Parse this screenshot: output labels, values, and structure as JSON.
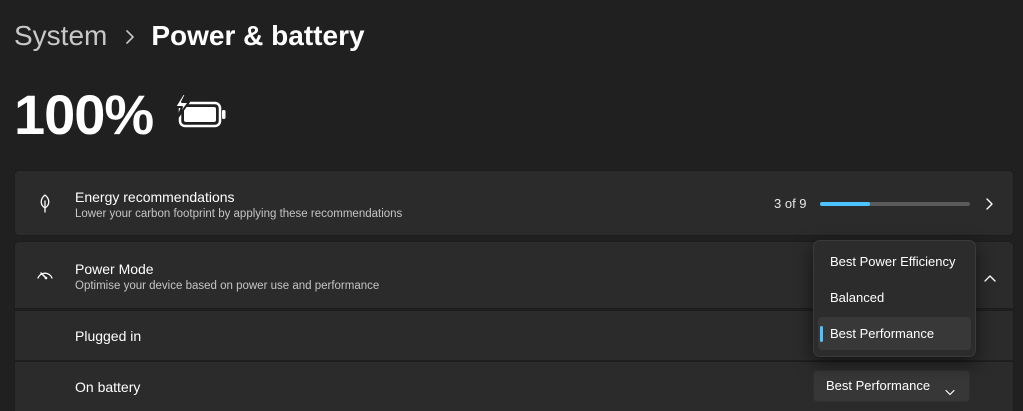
{
  "breadcrumb": {
    "parent": "System",
    "current": "Power & battery"
  },
  "battery": {
    "percent_label": "100%",
    "level": 1.0,
    "charging": true
  },
  "energy_card": {
    "title": "Energy recommendations",
    "subtitle": "Lower your carbon footprint by applying these recommendations",
    "progress_text": "3 of 9",
    "progress_fraction": 0.333,
    "icon": "leaf-icon"
  },
  "power_mode_card": {
    "title": "Power Mode",
    "subtitle": "Optimise your device based on power use and performance",
    "icon": "speedometer-icon",
    "expanded": true
  },
  "plugged_in": {
    "label": "Plugged in"
  },
  "on_battery": {
    "label": "On battery",
    "value": "Best Performance"
  },
  "dropdown": {
    "options": [
      "Best Power Efficiency",
      "Balanced",
      "Best Performance"
    ],
    "selected_index": 2
  },
  "colors": {
    "background": "#202020",
    "card": "#2b2b2b",
    "accent": "#4cc2ff"
  }
}
